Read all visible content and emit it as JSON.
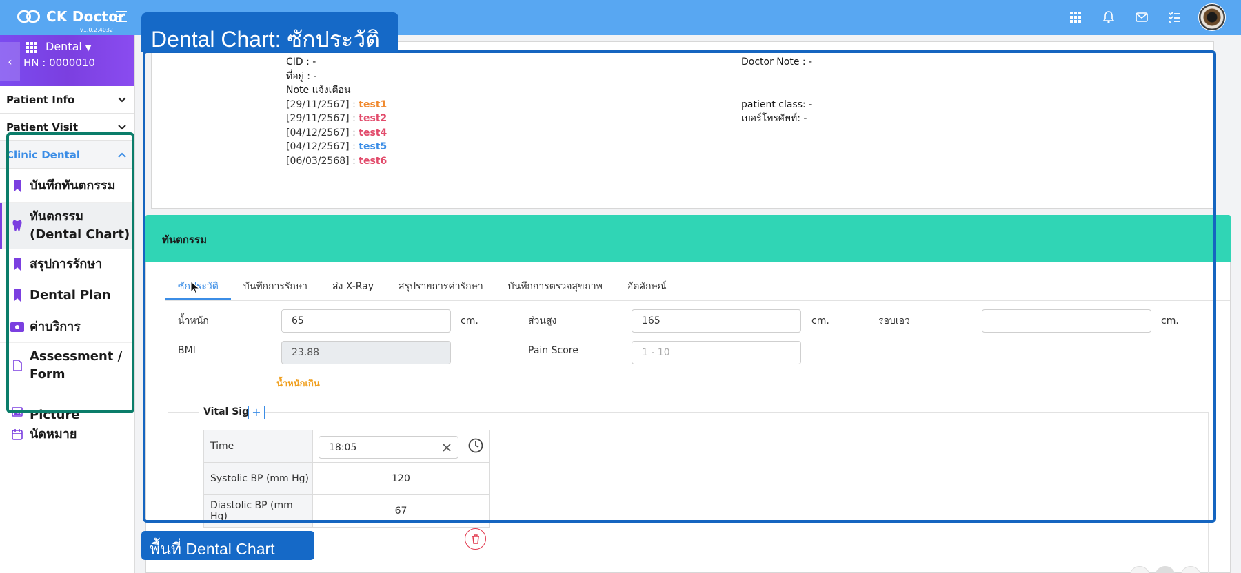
{
  "topbar": {
    "app_name": "CK Doctor",
    "version": "v1.0.2.4032",
    "icons": [
      "apps-grid-icon",
      "bell-icon",
      "mail-icon",
      "checklist-icon"
    ],
    "accent_color": "#58a7f2"
  },
  "sidebar": {
    "department": "Dental",
    "hn": "HN : 0000010",
    "sections": [
      {
        "label": "Patient Info"
      },
      {
        "label": "Patient Visit"
      },
      {
        "label": "Clinic Dental"
      }
    ],
    "items": [
      {
        "label": "บันทึกทันตกรรม",
        "icon": "tooth-bookmark-icon"
      },
      {
        "label": "ทันตกรรม (Dental Chart)",
        "icon": "tooth-icon"
      },
      {
        "label": "สรุปการรักษา",
        "icon": "bookmark-icon"
      },
      {
        "label": "Dental Plan",
        "icon": "bookmark-icon"
      },
      {
        "label": "ค่าบริการ",
        "icon": "money-icon"
      },
      {
        "label": "Assessment / Form",
        "icon": "document-icon"
      },
      {
        "label": "Picture",
        "icon": "image-icon"
      },
      {
        "label": "นัดหมาย",
        "icon": "calendar-icon"
      }
    ]
  },
  "patient": {
    "cid": "CID : -",
    "address": "ที่อยู่ : -",
    "note_title": "Note แจ้งเตือน",
    "notes": [
      {
        "date": "[29/11/2567]",
        "text": "test1",
        "color": "#f0892e"
      },
      {
        "date": "[29/11/2567]",
        "text": "test2",
        "color": "#e24b6b"
      },
      {
        "date": "[04/12/2567]",
        "text": "test4",
        "color": "#e24b6b"
      },
      {
        "date": "[04/12/2567]",
        "text": "test5",
        "color": "#3b8de6"
      },
      {
        "date": "[06/03/2568]",
        "text": "test6",
        "color": "#e24b6b"
      }
    ],
    "doctor_note": "Doctor Note :  -",
    "patient_class": "patient class: -",
    "phone": "เบอร์โทรศัพท์: -"
  },
  "dental": {
    "header": "ทันตกรรม",
    "tabs": [
      "ซักประวัติ",
      "บันทึกการรักษา",
      "ส่ง X-Ray",
      "สรุปรายการค่ารักษา",
      "บันทึกการตรวจสุขภาพ",
      "อัตลักษณ์"
    ],
    "active_tab": 0,
    "form": {
      "weight_label": "น้ำหนัก",
      "weight": "65",
      "weight_unit": "cm.",
      "height_label": "ส่วนสูง",
      "height": "165",
      "height_unit": "cm.",
      "waist_label": "รอบเอว",
      "waist": "",
      "waist_unit": "cm.",
      "bmi_label": "BMI",
      "bmi": "23.88",
      "pain_label": "Pain Score",
      "pain_placeholder": "1 - 10",
      "bmi_note": "น้ำหนักเกิน"
    },
    "vital": {
      "title": "Vital Sign",
      "rows": [
        {
          "label": "Time",
          "value": "18:05"
        },
        {
          "label": "Systolic BP (mm Hg)",
          "value": "120"
        },
        {
          "label": "Diastolic BP (mm Hg)",
          "value": "67"
        }
      ]
    }
  },
  "annotations": {
    "top_label": "Dental Chart: ซักประวัติ",
    "bottom_label": "พื้นที่ Dental Chart",
    "blue": "#1565c0",
    "green": "#0b7d6a"
  }
}
